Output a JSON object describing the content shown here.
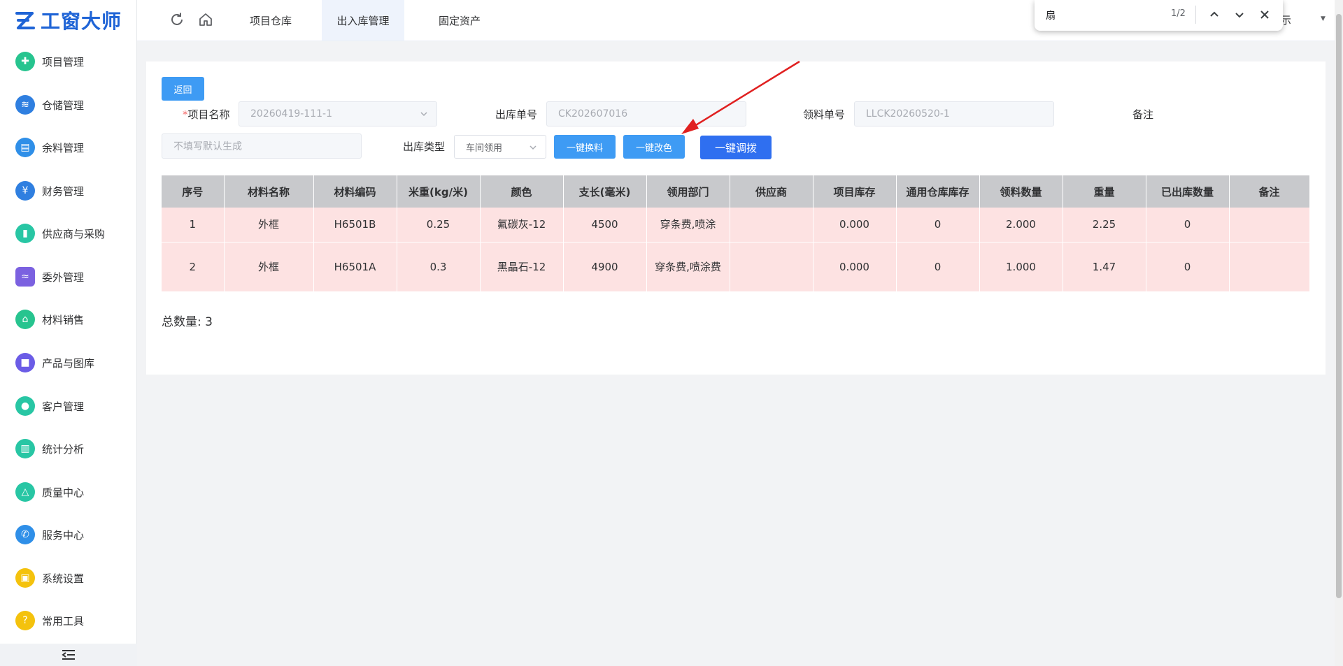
{
  "app": {
    "logo_text": "工窗大师"
  },
  "sidebar": {
    "items": [
      {
        "label": "项目管理",
        "icon": "cross-icon",
        "color": "#27c48f"
      },
      {
        "label": "仓储管理",
        "icon": "layers-icon",
        "color": "#2f7fe0"
      },
      {
        "label": "余料管理",
        "icon": "document-icon",
        "color": "#2f8fe8"
      },
      {
        "label": "财务管理",
        "icon": "finance-icon",
        "color": "#2f7fe0"
      },
      {
        "label": "供应商与采购",
        "icon": "clipboard-icon",
        "color": "#28c6a4"
      },
      {
        "label": "委外管理",
        "icon": "handshake-icon",
        "color": "#7b61e0"
      },
      {
        "label": "材料销售",
        "icon": "sale-icon",
        "color": "#27c48f"
      },
      {
        "label": "产品与图库",
        "icon": "cube-icon",
        "color": "#6b5ce6"
      },
      {
        "label": "客户管理",
        "icon": "user-icon",
        "color": "#28c6a4"
      },
      {
        "label": "统计分析",
        "icon": "chart-icon",
        "color": "#28c6a4"
      },
      {
        "label": "质量中心",
        "icon": "flask-icon",
        "color": "#28c6a4"
      },
      {
        "label": "服务中心",
        "icon": "phone-icon",
        "color": "#2f8fe8"
      },
      {
        "label": "系统设置",
        "icon": "settings-icon",
        "color": "#f4c20d"
      },
      {
        "label": "常用工具",
        "icon": "question-icon",
        "color": "#f4c20d"
      }
    ]
  },
  "topbar": {
    "tabs": [
      {
        "label": "项目仓库"
      },
      {
        "label": "出入库管理"
      },
      {
        "label": "固定资产"
      }
    ],
    "user_fragment": "示"
  },
  "findbar": {
    "query": "扇",
    "count": "1/2"
  },
  "form": {
    "back_label": "返回",
    "project_label": "项目名称",
    "project_required_mark": "*",
    "project_value": "20260419-111-1",
    "out_no_label": "出库单号",
    "out_no_value": "CK202607016",
    "pick_no_label": "领料单号",
    "pick_no_value": "LLCK20260520-1",
    "remark_label": "备注",
    "remark_placeholder": "不填写默认生成",
    "type_label": "出库类型",
    "type_value": "车间领用",
    "btn_replace": "一键换料",
    "btn_recolor": "一键改色",
    "btn_transfer": "一键调拨"
  },
  "table": {
    "headers": [
      "序号",
      "材料名称",
      "材料编码",
      "米重(kg/米)",
      "颜色",
      "支长(毫米)",
      "领用部门",
      "供应商",
      "项目库存",
      "通用仓库库存",
      "领料数量",
      "重量",
      "已出库数量",
      "备注"
    ],
    "rows": [
      [
        "1",
        "外框",
        "H6501B",
        "0.25",
        "氟碳灰-12",
        "4500",
        "穿条费,喷涂",
        "",
        "0.000",
        "0",
        "2.000",
        "2.25",
        "0",
        ""
      ],
      [
        "2",
        "外框",
        "H6501A",
        "0.3",
        "黑晶石-12",
        "4900",
        "穿条费,喷涂费",
        "",
        "0.000",
        "0",
        "1.000",
        "1.47",
        "0",
        ""
      ]
    ]
  },
  "summary": {
    "total_label": "总数量:",
    "total_value": "3"
  },
  "colors": {
    "primary": "#3e9bf4",
    "primary_dark": "#2f6ff0",
    "row_highlight": "#fde2e2",
    "header_bg": "#c8c9cc",
    "annotation": "#e02020"
  }
}
